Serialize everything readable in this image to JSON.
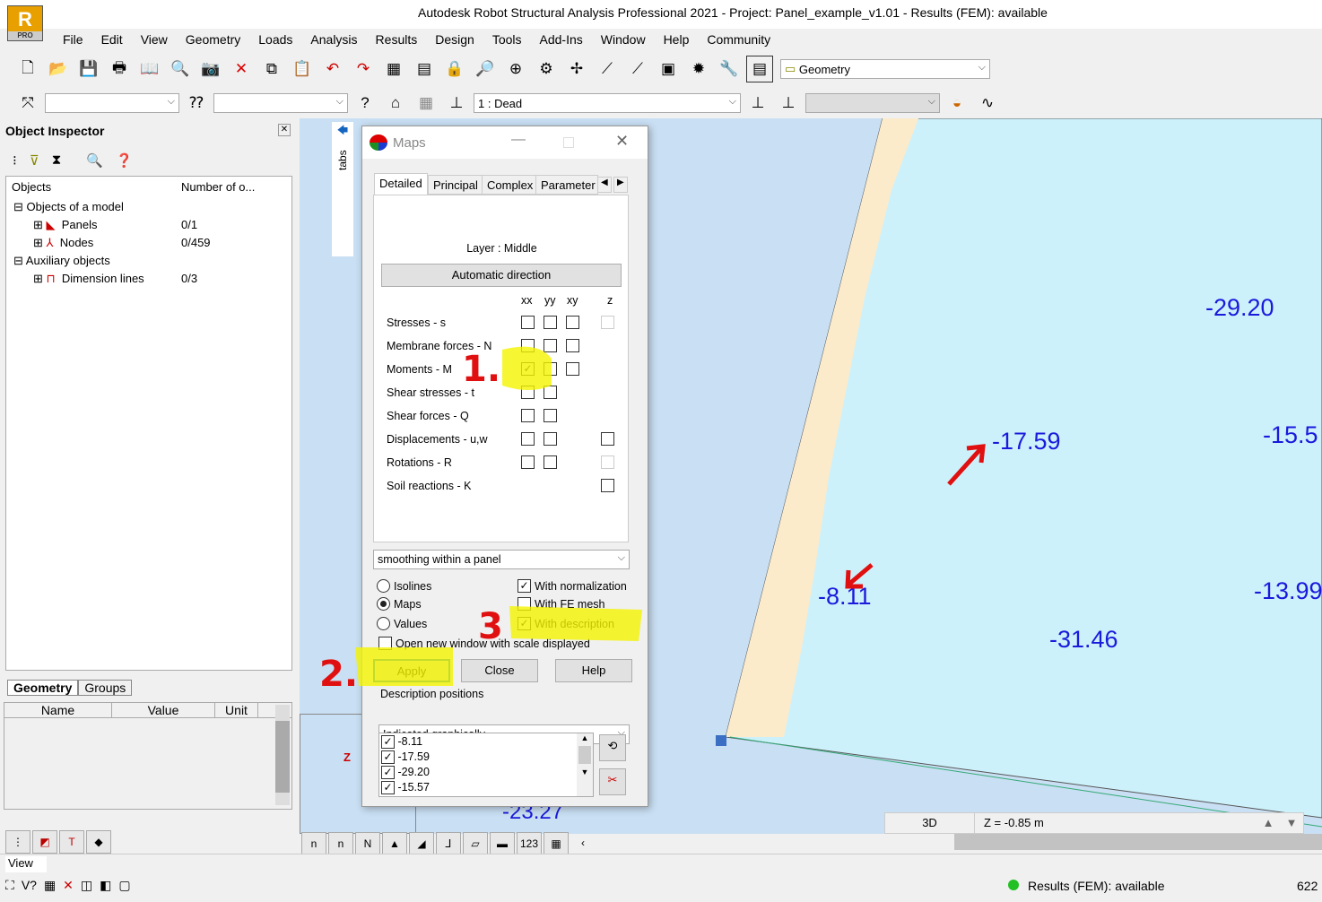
{
  "app": {
    "title": "Autodesk Robot Structural Analysis Professional 2021 - Project: Panel_example_v1.01 - Results (FEM): available",
    "icon_letter": "R",
    "icon_badge": "PRO"
  },
  "menu": [
    "File",
    "Edit",
    "View",
    "Geometry",
    "Loads",
    "Analysis",
    "Results",
    "Design",
    "Tools",
    "Add-Ins",
    "Window",
    "Help",
    "Community"
  ],
  "toolbar": {
    "layout_select": "Geometry",
    "load_case_select": "1 : Dead"
  },
  "inspector": {
    "title": "Object Inspector",
    "col_objects": "Objects",
    "col_number": "Number of o...",
    "rows": [
      {
        "label": "Objects of a model",
        "value": ""
      },
      {
        "label": "Panels",
        "value": "0/1"
      },
      {
        "label": "Nodes",
        "value": "0/459"
      },
      {
        "label": "Auxiliary objects",
        "value": ""
      },
      {
        "label": "Dimension lines",
        "value": "0/3"
      }
    ],
    "tabs": [
      "Geometry",
      "Groups"
    ],
    "prop_cols": [
      "Name",
      "Value",
      "Unit"
    ]
  },
  "side_tab": "tabs",
  "dialog": {
    "title": "Maps",
    "tabs": [
      "Detailed",
      "Principal",
      "Complex",
      "Parameter"
    ],
    "layer": "Layer : Middle",
    "auto_dir": "Automatic direction",
    "cols": [
      "xx",
      "yy",
      "xy",
      "z"
    ],
    "rows": [
      {
        "label": "Stresses - s",
        "checks": [
          false,
          false,
          false,
          false
        ]
      },
      {
        "label": "Membrane forces - N",
        "checks": [
          false,
          false,
          false,
          null
        ]
      },
      {
        "label": "Moments - M",
        "checks": [
          true,
          false,
          false,
          null
        ]
      },
      {
        "label": "Shear stresses - t",
        "checks": [
          false,
          false,
          null,
          null
        ]
      },
      {
        "label": "Shear forces - Q",
        "checks": [
          false,
          false,
          null,
          null
        ]
      },
      {
        "label": "Displacements - u,w",
        "checks": [
          false,
          false,
          null,
          false
        ]
      },
      {
        "label": "Rotations - R",
        "checks": [
          false,
          false,
          null,
          false
        ]
      },
      {
        "label": "Soil reactions - K",
        "checks": [
          null,
          null,
          null,
          false
        ]
      }
    ],
    "smoothing": "smoothing within a panel",
    "modes": [
      {
        "label": "Isolines",
        "selected": false
      },
      {
        "label": "Maps",
        "selected": true
      },
      {
        "label": "Values",
        "selected": false
      }
    ],
    "options": [
      {
        "label": "With normalization",
        "checked": true
      },
      {
        "label": "With FE mesh",
        "checked": false
      },
      {
        "label": "With description",
        "checked": true
      }
    ],
    "new_window": "Open new window with scale displayed",
    "apply": "Apply",
    "close": "Close",
    "help": "Help",
    "desc_pos_label": "Description positions",
    "desc_pos": "Indicated graphically",
    "desc_list": [
      "-8.11",
      "-17.59",
      "-29.20",
      "-15.57"
    ]
  },
  "viewport": {
    "values": [
      "-29.20",
      "-17.59",
      "-15.5",
      "-8.11",
      "-13.99",
      "-31.46",
      "-23.27"
    ],
    "view_mode": "3D",
    "z_level": "Z = -0.85 m"
  },
  "annotations": [
    "1.",
    "2.",
    "3"
  ],
  "bottom": {
    "view_label": "View",
    "status": "Results (FEM): available",
    "status_color": "#22c022",
    "count": "622"
  }
}
